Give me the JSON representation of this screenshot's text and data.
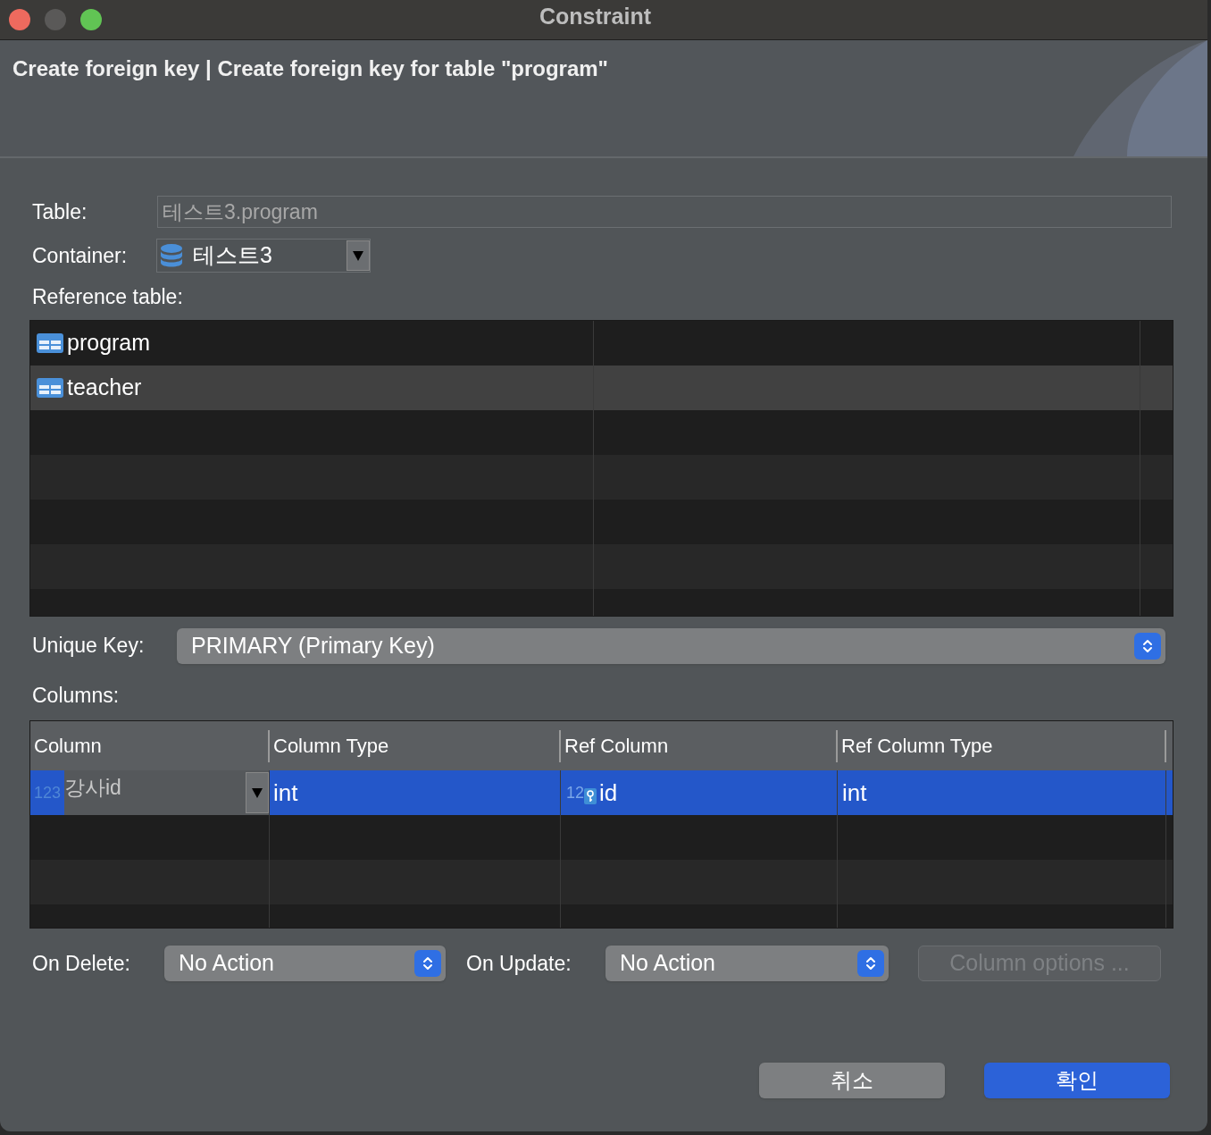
{
  "window": {
    "title": "Constraint"
  },
  "header": {
    "title": "Create foreign key | Create foreign key for table \"program\""
  },
  "table_field": {
    "label": "Table:",
    "value": "테스트3.program",
    "disabled": true
  },
  "container": {
    "label": "Container:",
    "value": "테스트3"
  },
  "reference_table": {
    "label": "Reference table:",
    "rows": [
      {
        "name": "program",
        "selected": false
      },
      {
        "name": "teacher",
        "selected": true
      }
    ]
  },
  "unique_key": {
    "label": "Unique Key:",
    "value": "PRIMARY (Primary Key)"
  },
  "columns": {
    "label": "Columns:",
    "headers": [
      "Column",
      "Column Type",
      "Ref Column",
      "Ref Column Type"
    ],
    "rows": [
      {
        "type_badge": "123",
        "column": "강사id",
        "column_type": "int",
        "ref_type_badge": "12",
        "ref_column": "id",
        "ref_column_type": "int",
        "selected": true
      }
    ]
  },
  "on_delete": {
    "label": "On Delete:",
    "value": "No Action"
  },
  "on_update": {
    "label": "On Update:",
    "value": "No Action"
  },
  "column_options": {
    "label": "Column options ...",
    "disabled": true
  },
  "buttons": [
    {
      "label": "취소",
      "kind": "secondary"
    },
    {
      "label": "확인",
      "kind": "primary"
    }
  ]
}
